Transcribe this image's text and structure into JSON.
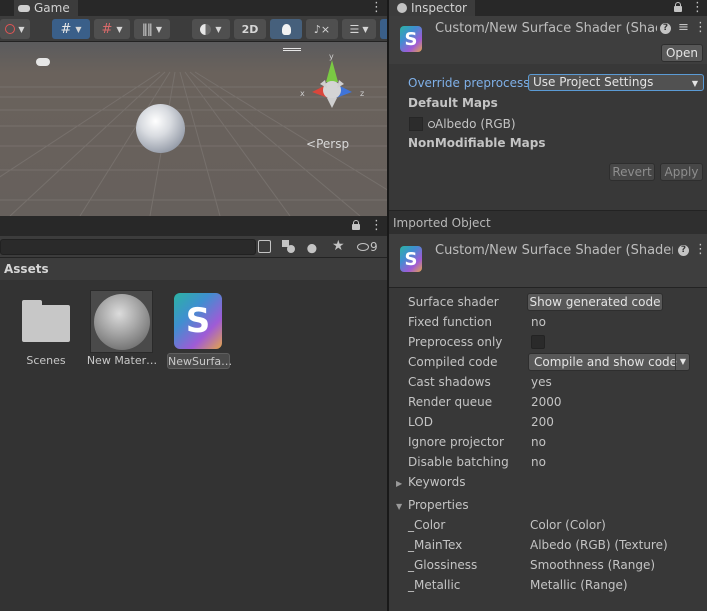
{
  "scene": {
    "tab_label": "Game",
    "btn_2d": "2D",
    "persp_label": "Persp",
    "gizmo": {
      "y": "y",
      "x": "x",
      "z": "z"
    }
  },
  "project": {
    "hidden_count": "9",
    "assets_header": "Assets",
    "assets": [
      {
        "label": "Scenes",
        "type": "folder"
      },
      {
        "label": "New Mater…",
        "type": "material"
      },
      {
        "label": "NewSurfa…",
        "type": "shader"
      }
    ]
  },
  "inspector": {
    "tab_label": "Inspector",
    "title": "Custom/New Surface Shader (Shac",
    "open_label": "Open",
    "override_label": "Override preprocesso",
    "override_value": "Use Project Settings",
    "default_maps_label": "Default Maps",
    "albedo_label": "Albedo (RGB)",
    "nonmodifiable_label": "NonModifiable Maps",
    "revert_label": "Revert",
    "apply_label": "Apply",
    "imported_object_label": "Imported Object",
    "object_title": "Custom/New Surface Shader (Shader",
    "rows": {
      "surface_shader_label": "Surface shader",
      "surface_shader_button": "Show generated code",
      "fixed_function_label": "Fixed function",
      "fixed_function_value": "no",
      "preprocess_label": "Preprocess only",
      "compiled_code_label": "Compiled code",
      "compiled_code_button": "Compile and show code",
      "cast_shadows_label": "Cast shadows",
      "cast_shadows_value": "yes",
      "render_queue_label": "Render queue",
      "render_queue_value": "2000",
      "lod_label": "LOD",
      "lod_value": "200",
      "ignore_projector_label": "Ignore projector",
      "ignore_projector_value": "no",
      "disable_batching_label": "Disable batching",
      "disable_batching_value": "no"
    },
    "keywords_label": "Keywords",
    "properties_label": "Properties",
    "properties": [
      {
        "name": "_Color",
        "value": "Color (Color)"
      },
      {
        "name": "_MainTex",
        "value": "Albedo (RGB) (Texture)"
      },
      {
        "name": "_Glossiness",
        "value": "Smoothness (Range)"
      },
      {
        "name": "_Metallic",
        "value": "Metallic (Range)"
      }
    ]
  },
  "colors": {
    "accent_blue": "#5b9bd5",
    "panel_bg": "#383838",
    "toolbar_bg": "#3c3c3c"
  }
}
